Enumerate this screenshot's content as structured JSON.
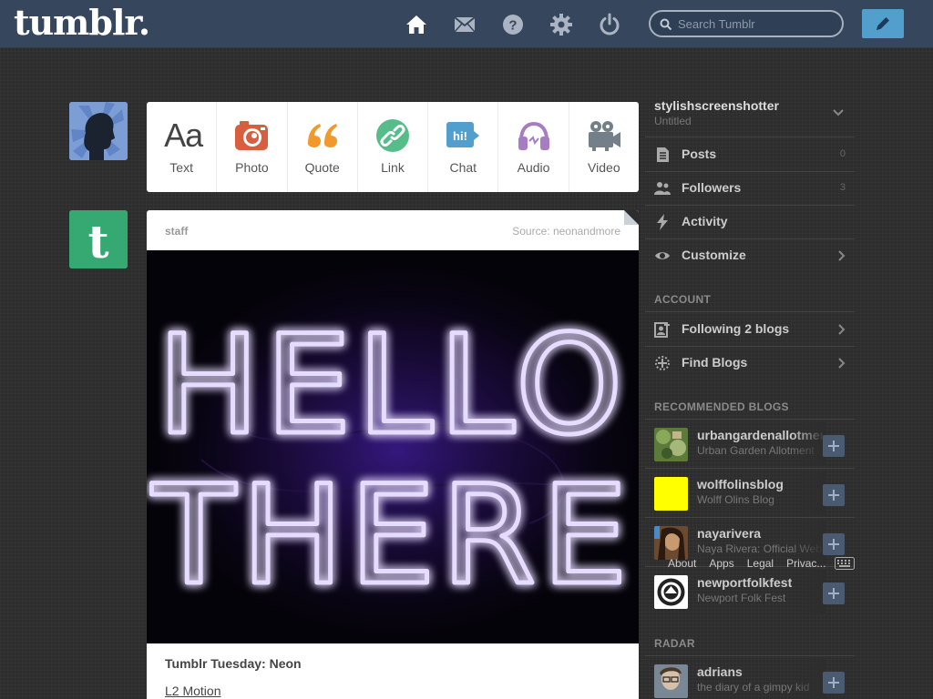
{
  "header": {
    "logo": "tumblr.",
    "nav": [
      {
        "name": "home-icon"
      },
      {
        "name": "mail-icon"
      },
      {
        "name": "help-icon"
      },
      {
        "name": "gear-icon"
      },
      {
        "name": "power-icon"
      }
    ],
    "search_placeholder": "Search Tumblr",
    "accent": "#36465d",
    "compose_color": "#529ecc"
  },
  "post_types": [
    {
      "label": "Text",
      "icon": "text-aa-icon",
      "glyph": "Aa",
      "color": "#444444"
    },
    {
      "label": "Photo",
      "icon": "camera-icon",
      "color": "#d95e40"
    },
    {
      "label": "Quote",
      "icon": "quote-icon",
      "color": "#f2992e"
    },
    {
      "label": "Link",
      "icon": "link-icon",
      "color": "#56bc8a"
    },
    {
      "label": "Chat",
      "icon": "chat-icon",
      "glyph": "hi!",
      "color": "#529ecc"
    },
    {
      "label": "Audio",
      "icon": "headphones-icon",
      "color": "#a77dc2"
    },
    {
      "label": "Video",
      "icon": "video-camera-icon",
      "color": "#748089"
    }
  ],
  "post": {
    "author": "staff",
    "source": "Source: neonandmore",
    "neon_line1": "HELLO",
    "neon_line2": "THERE",
    "title": "Tumblr Tuesday: Neon",
    "link": "L2 Motion"
  },
  "sidebar": {
    "blog_name": "stylishscreenshotter",
    "blog_subtitle": "Untitled",
    "items": [
      {
        "label": "Posts",
        "count": "0",
        "icon": "posts-icon"
      },
      {
        "label": "Followers",
        "count": "3",
        "icon": "followers-icon"
      },
      {
        "label": "Activity",
        "icon": "activity-icon"
      },
      {
        "label": "Customize",
        "icon": "eye-icon"
      }
    ],
    "account_header": "ACCOUNT",
    "account_items": [
      {
        "label": "Following 2 blogs",
        "icon": "following-icon"
      },
      {
        "label": "Find Blogs",
        "icon": "find-blogs-icon"
      }
    ],
    "recommended_header": "RECOMMENDED BLOGS",
    "recommended": [
      {
        "name": "urbangardenallotment",
        "sub": "Urban Garden Allotment",
        "color": "#6b8b4a"
      },
      {
        "name": "wolffolinsblog",
        "sub": "Wolff Olins Blog",
        "color": "#ffff00"
      },
      {
        "name": "nayarivera",
        "sub": "Naya Rivera: Official Website",
        "color": "#8a6a4a"
      },
      {
        "name": "newportfolkfest",
        "sub": "Newport Folk Fest",
        "color": "#ffffff"
      }
    ],
    "footer": [
      "About",
      "Apps",
      "Legal",
      "Privac..."
    ],
    "radar_header": "RADAR",
    "radar": {
      "name": "adrians",
      "sub": "the diary of a gimpy kid",
      "color": "#8c9aa8"
    }
  }
}
